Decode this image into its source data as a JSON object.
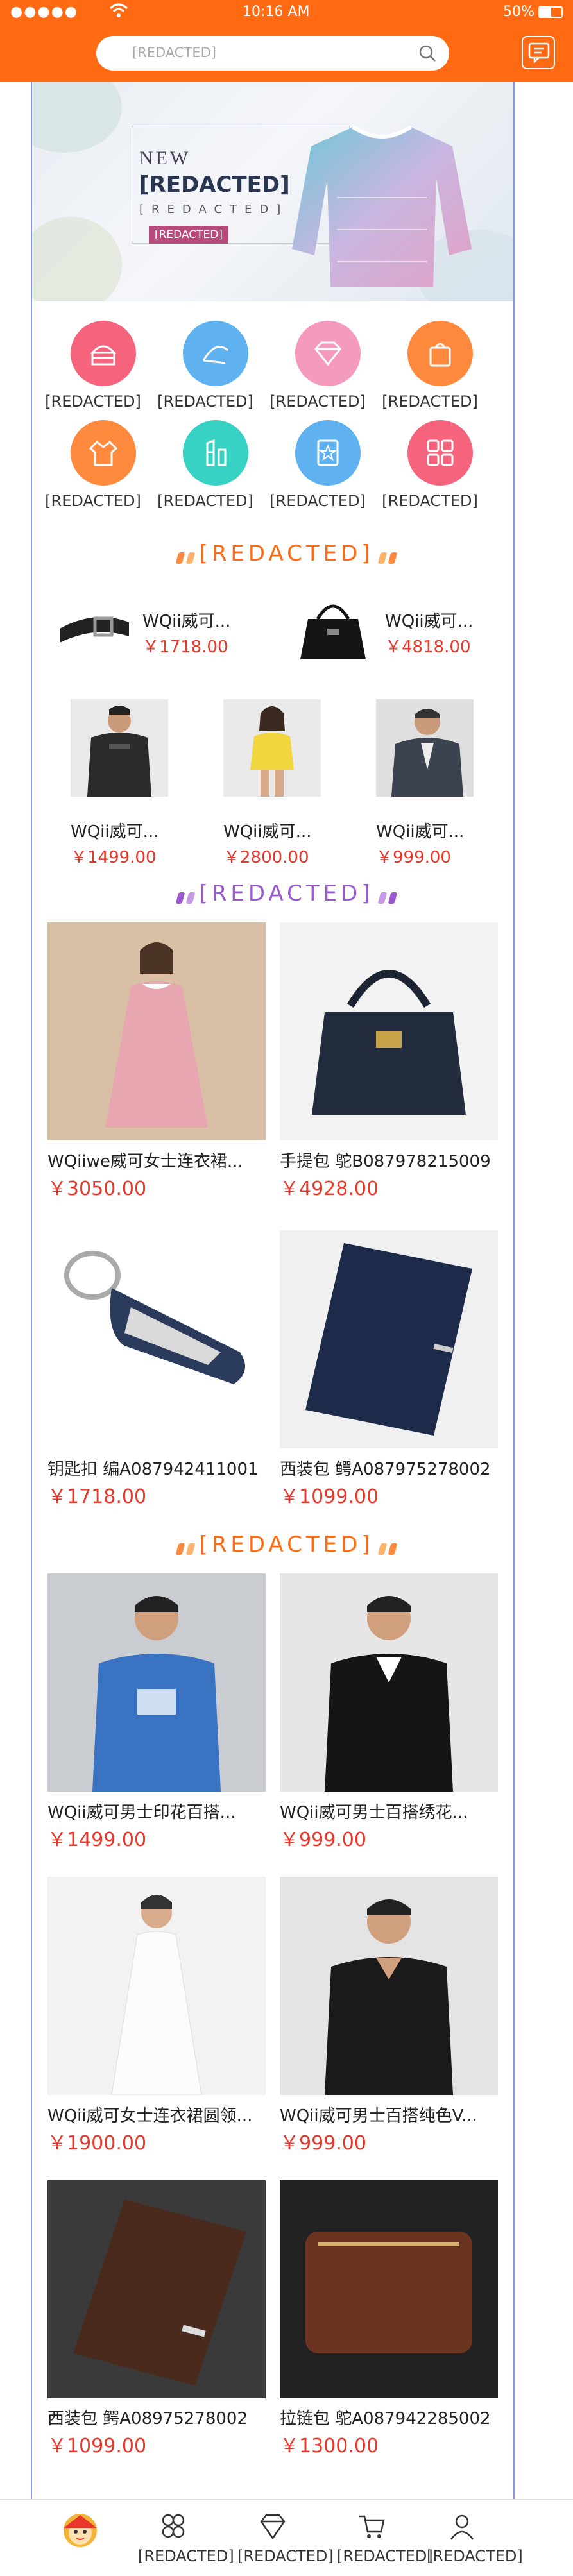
{
  "status_bar": {
    "signal": "●●●●●",
    "time": "10:16 AM",
    "battery": "50%"
  },
  "header": {
    "search_placeholder": "[REDACTED]"
  },
  "banner": {
    "new_text": "NEW",
    "title": "[REDACTED]",
    "subtitle": "[REDACTED]",
    "cta": "[REDACTED]"
  },
  "categories": [
    {
      "label": "[REDACTED]",
      "icon": "cake-icon",
      "color": "#f5647c"
    },
    {
      "label": "[REDACTED]",
      "icon": "hat-icon",
      "color": "#5fb2ef"
    },
    {
      "label": "[REDACTED]",
      "icon": "diamond-icon",
      "color": "#f59abf"
    },
    {
      "label": "[REDACTED]",
      "icon": "bag-icon",
      "color": "#ff8a3d"
    },
    {
      "label": "[REDACTED]",
      "icon": "shirt-icon",
      "color": "#ff8a3d"
    },
    {
      "label": "[REDACTED]",
      "icon": "lipstick-icon",
      "color": "#38d2c4"
    },
    {
      "label": "[REDACTED]",
      "icon": "star-tag-icon",
      "color": "#5fb2ef"
    },
    {
      "label": "[REDACTED]",
      "icon": "grid-icon",
      "color": "#f5647c"
    }
  ],
  "sections": {
    "new": "[REDACTED]",
    "featured": "[REDACTED]",
    "hot": "[REDACTED]"
  },
  "new_products": [
    {
      "name": "WQii威可...",
      "price": "￥1718.00"
    },
    {
      "name": "WQii威可...",
      "price": "￥4818.00"
    },
    {
      "name": "WQii威可...",
      "price": "￥1499.00"
    },
    {
      "name": "WQii威可...",
      "price": "￥2800.00"
    },
    {
      "name": "WQii威可...",
      "price": "￥999.00"
    }
  ],
  "featured_products": [
    {
      "name": "WQiiwe威可女士连衣裙...",
      "price": "￥3050.00"
    },
    {
      "name": "手提包 鸵B087978215009",
      "price": "￥4928.00"
    },
    {
      "name": "钥匙扣 编A087942411001",
      "price": "￥1718.00"
    },
    {
      "name": "西装包 鳄A087975278002",
      "price": "￥1099.00"
    }
  ],
  "hot_products": [
    {
      "name": "WQii威可男士印花百搭...",
      "price": "￥1499.00"
    },
    {
      "name": "WQii威可男士百搭绣花...",
      "price": "￥999.00"
    },
    {
      "name": "WQii威可女士连衣裙圆领...",
      "price": "￥1900.00"
    },
    {
      "name": "WQii威可男士百搭纯色V...",
      "price": "￥999.00"
    },
    {
      "name": "西装包 鳄A08975278002",
      "price": "￥1099.00"
    },
    {
      "name": "拉链包 鸵A087942285002",
      "price": "￥1300.00"
    }
  ],
  "tabbar": [
    {
      "label": "",
      "icon": "home-mascot-icon"
    },
    {
      "label": "[REDACTED]",
      "icon": "category-icon"
    },
    {
      "label": "[REDACTED]",
      "icon": "vip-diamond-icon"
    },
    {
      "label": "[REDACTED]",
      "icon": "cart-icon"
    },
    {
      "label": "[REDACTED]",
      "icon": "user-icon"
    }
  ],
  "colors": {
    "accent": "#ff6a13",
    "price": "#e8382b",
    "featured_title": "#9b59d0",
    "guide": "#2c3ccb"
  }
}
